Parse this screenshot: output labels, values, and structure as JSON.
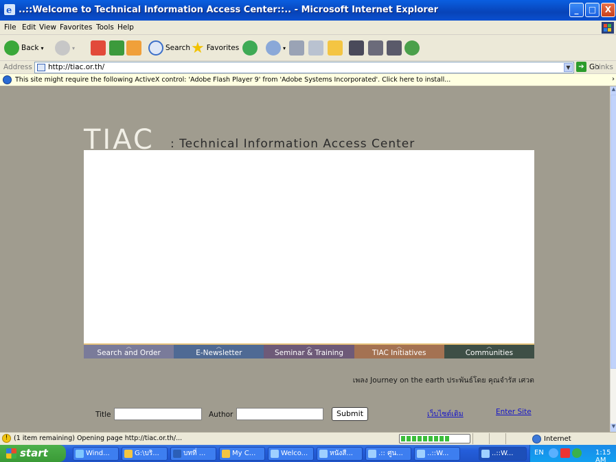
{
  "window": {
    "title": "..::Welcome to Technical Information Access Center::.. - Microsoft Internet Explorer",
    "minimize": "_",
    "maximize": "□",
    "close": "X"
  },
  "menu": [
    "File",
    "Edit",
    "View",
    "Favorites",
    "Tools",
    "Help"
  ],
  "toolbar": {
    "back_label": "Back",
    "search_label": "Search",
    "favorites_label": "Favorites"
  },
  "address": {
    "label": "Address",
    "url": "http://tiac.or.th/",
    "go_label": "Go",
    "links_label": "Links"
  },
  "infobar": {
    "message": "This site might require the following ActiveX control: 'Adobe Flash Player 9' from 'Adobe Systems Incorporated'. Click here to install..."
  },
  "page": {
    "logo": "TIAC",
    "subtitle": ": Technical Information Access Center",
    "nav": [
      {
        "label": "Search and Order",
        "color": "#7a7b9a"
      },
      {
        "label": "E-Newsletter",
        "color": "#4f6a94"
      },
      {
        "label": "Seminar & Training",
        "color": "#6e5a78"
      },
      {
        "label": "TIAC Initiatives",
        "color": "#a47252"
      },
      {
        "label": "Communities",
        "color": "#3e4f46"
      }
    ],
    "song": "เพลง  Journey on the earth ประพันธ์โดย คุณจำรัส เศวต",
    "form": {
      "title_label": "Title",
      "author_label": "Author",
      "submit_label": "Submit",
      "old_site_link": "เว็บไซต์เดิม",
      "enter_site_link": "Enter Site"
    }
  },
  "status": {
    "text": "(1 item remaining) Opening page http://tiac.or.th/...",
    "progress": 0.7,
    "zone": "Internet"
  },
  "taskbar": {
    "start_label": "start",
    "tasks": [
      "Wind...",
      "G:\\บริ...",
      "บทที่ ...",
      "My C...",
      "Welco...",
      "หนังสื...",
      ".:: ศูน...",
      "..::W...",
      "..::W..."
    ],
    "lang": "EN",
    "time": "1:15 AM"
  }
}
